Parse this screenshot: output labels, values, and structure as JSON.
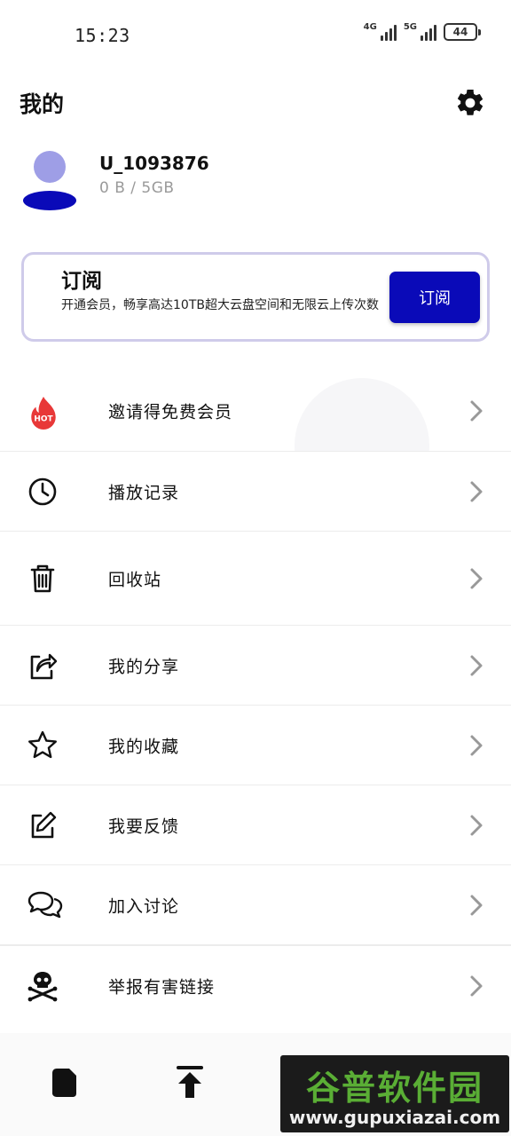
{
  "status_bar": {
    "time": "15:23",
    "network_1": "4G",
    "network_2": "5G",
    "battery": "44"
  },
  "header": {
    "title": "我的",
    "settings_icon": "gear-icon"
  },
  "profile": {
    "username": "U_1093876",
    "storage": "0 B / 5GB",
    "avatar_colors": {
      "head": "#9e9ee6",
      "body": "#0a0ab8"
    }
  },
  "subscription": {
    "title": "订阅",
    "description": "开通会员，畅享高达10TB超大云盘空间和无限云上传次数",
    "button_label": "订阅",
    "accent_color": "#0a0ab8"
  },
  "menu": {
    "items": [
      {
        "label": "邀请得免费会员",
        "icon": "hot-flame-icon",
        "badge": "HOT"
      },
      {
        "label": "播放记录",
        "icon": "clock-icon"
      },
      {
        "label": "回收站",
        "icon": "trash-icon"
      },
      {
        "label": "我的分享",
        "icon": "share-icon"
      },
      {
        "label": "我的收藏",
        "icon": "star-icon"
      },
      {
        "label": "我要反馈",
        "icon": "edit-icon"
      },
      {
        "label": "加入讨论",
        "icon": "chat-bubbles-icon"
      },
      {
        "label": "举报有害链接",
        "icon": "skull-crossbones-icon"
      }
    ]
  },
  "bottom_nav": {
    "items": [
      {
        "icon": "file-icon"
      },
      {
        "icon": "upload-icon"
      }
    ]
  },
  "watermark": {
    "title": "谷普软件园",
    "url": "www.gupuxiazai.com"
  }
}
